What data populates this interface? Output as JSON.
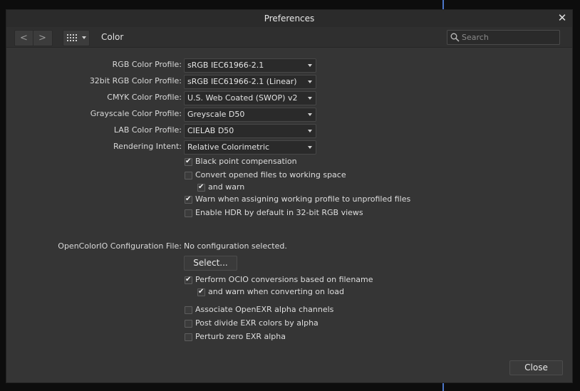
{
  "dialog": {
    "title": "Preferences"
  },
  "toolbar": {
    "back_glyph": "<",
    "forward_glyph": ">",
    "section": "Color",
    "search_placeholder": "Search"
  },
  "profiles": [
    {
      "label": "RGB Color Profile:",
      "value": "sRGB IEC61966-2.1"
    },
    {
      "label": "32bit RGB Color Profile:",
      "value": "sRGB IEC61966-2.1 (Linear)"
    },
    {
      "label": "CMYK Color Profile:",
      "value": "U.S. Web Coated (SWOP) v2"
    },
    {
      "label": "Grayscale Color Profile:",
      "value": "Greyscale D50"
    },
    {
      "label": "LAB Color Profile:",
      "value": "CIELAB D50"
    },
    {
      "label": "Rendering Intent:",
      "value": "Relative Colorimetric"
    }
  ],
  "options": [
    {
      "label": "Black point compensation",
      "checked": true
    },
    {
      "label": "Convert opened files to working space",
      "checked": false
    },
    {
      "label": "and warn",
      "checked": true
    },
    {
      "label": "Warn when assigning working profile to unprofiled files",
      "checked": true
    },
    {
      "label": "Enable HDR by default in 32-bit RGB views",
      "checked": false
    }
  ],
  "ocio": {
    "label": "OpenColorIO Configuration File:",
    "value": "No configuration selected.",
    "select_button": "Select...",
    "options": [
      {
        "label": "Perform OCIO conversions based on filename",
        "checked": true
      },
      {
        "label": "and warn when converting on load",
        "checked": true
      },
      {
        "label": "Associate OpenEXR alpha channels",
        "checked": false
      },
      {
        "label": "Post divide EXR colors by alpha",
        "checked": false
      },
      {
        "label": "Perturb zero EXR alpha",
        "checked": false
      }
    ]
  },
  "footer": {
    "close_button": "Close"
  },
  "icons": {
    "close": "close-icon",
    "back": "chevron-left-icon",
    "forward": "chevron-right-icon",
    "grid": "grid-icon",
    "search": "search-icon",
    "dropdown": "chevron-down-icon",
    "checkmark": "checkmark-icon"
  },
  "colors": {
    "dialog_bg": "#353535",
    "titlebar_bg": "#2b2b2b",
    "field_bg": "#2a2a2a",
    "accent_line": "#4b76c9"
  }
}
